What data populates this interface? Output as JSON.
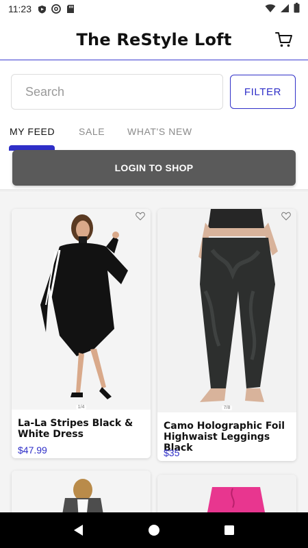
{
  "status_bar": {
    "time": "11:23"
  },
  "header": {
    "title": "The ReStyle Loft"
  },
  "search": {
    "placeholder": "Search",
    "value": ""
  },
  "filter": {
    "label": "FILTER"
  },
  "tabs": [
    {
      "label": "MY FEED",
      "active": true
    },
    {
      "label": "SALE",
      "active": false
    },
    {
      "label": "WHAT'S NEW",
      "active": false
    }
  ],
  "login": {
    "label": "LOGIN TO SHOP"
  },
  "products": [
    {
      "name": "La-La Stripes Black & White Dress",
      "price": "$47.99",
      "counter": "1/4"
    },
    {
      "name": "Camo Holographic Foil Highwaist Leggings Black",
      "price": "$35",
      "counter": "7/8"
    },
    {
      "name": "",
      "price": "",
      "counter": ""
    },
    {
      "name": "",
      "price": "",
      "counter": ""
    }
  ],
  "colors": {
    "accent": "#2f2fc8",
    "login_bg": "#5a5a5a",
    "nav_bg": "#000000"
  }
}
